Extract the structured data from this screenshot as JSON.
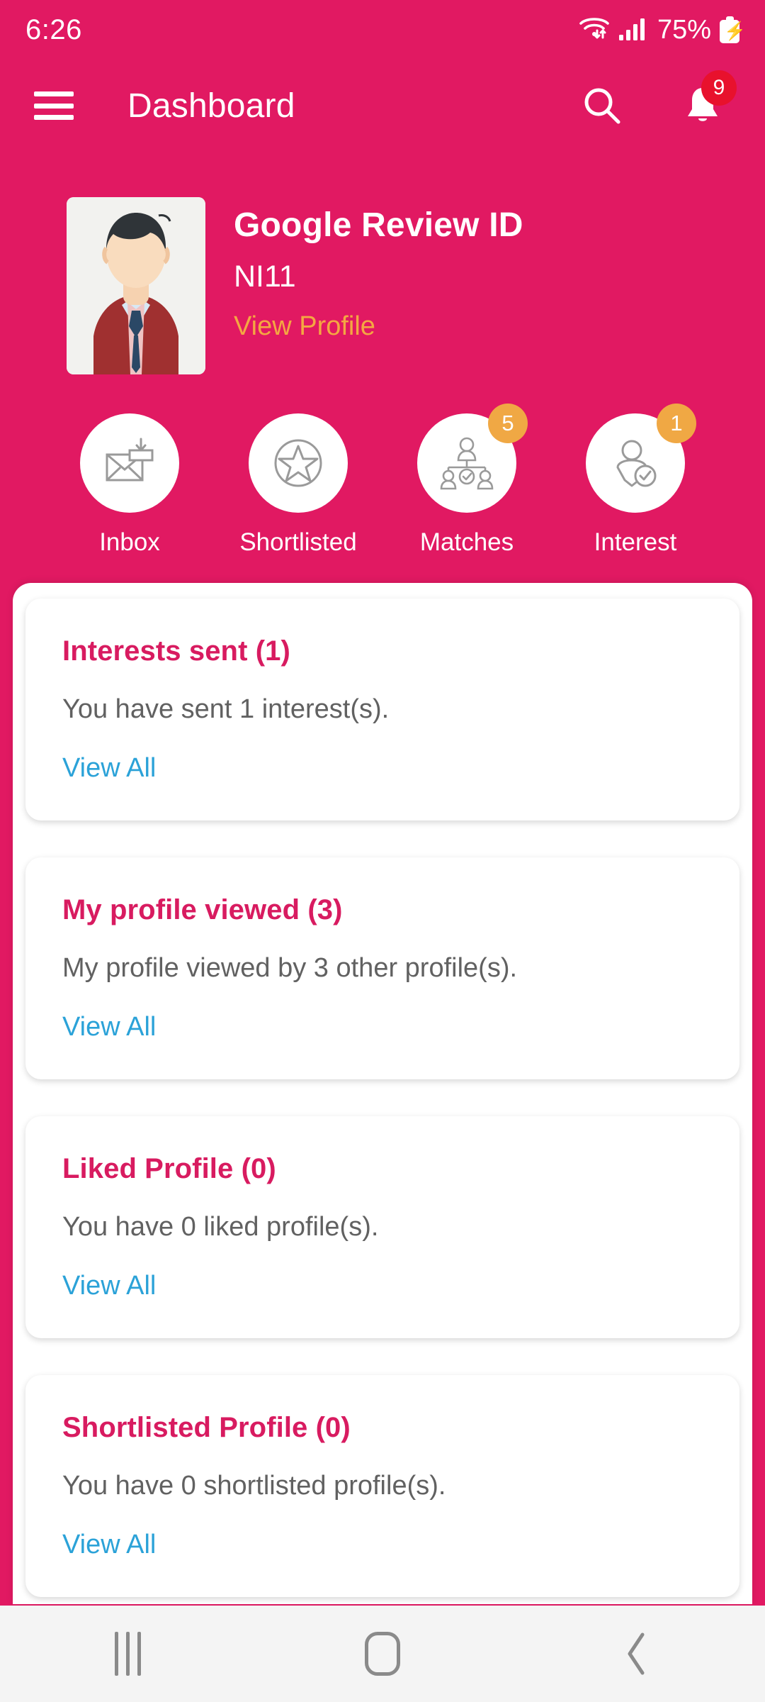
{
  "status_bar": {
    "time": "6:26",
    "battery_percent": "75%",
    "icons": [
      "wifi-icon",
      "cellular-signal-icon",
      "battery-charging-icon"
    ]
  },
  "app_bar": {
    "menu_icon": "hamburger-menu-icon",
    "title": "Dashboard",
    "search_icon": "search-icon",
    "notification_icon": "bell-icon",
    "notification_count": "9"
  },
  "profile": {
    "name": "Google Review ID",
    "id": "NI11",
    "view_profile_label": "View Profile",
    "avatar_icon": "user-avatar-photo"
  },
  "quick_actions": [
    {
      "label": "Inbox",
      "icon": "envelope-inbox-icon",
      "badge": ""
    },
    {
      "label": "Shortlisted",
      "icon": "star-circle-icon",
      "badge": ""
    },
    {
      "label": "Matches",
      "icon": "people-group-check-icon",
      "badge": "5"
    },
    {
      "label": "Interest",
      "icon": "person-check-icon",
      "badge": "1"
    }
  ],
  "cards": [
    {
      "title": "Interests sent (1)",
      "description": "You have sent 1 interest(s).",
      "link": "View All"
    },
    {
      "title": "My profile viewed (3)",
      "description": "My profile viewed by 3 other profile(s).",
      "link": "View All"
    },
    {
      "title": "Liked Profile (0)",
      "description": "You have 0 liked profile(s).",
      "link": "View All"
    },
    {
      "title": "Shortlisted Profile (0)",
      "description": "You have 0 shortlisted profile(s).",
      "link": "View All"
    }
  ],
  "nav_bar": {
    "recents_icon": "recents-icon",
    "home_icon": "home-icon",
    "back_icon": "back-chevron-icon"
  },
  "colors": {
    "brand_pink": "#E11962",
    "card_title": "#D81B60",
    "link_blue": "#2BA2D8",
    "accent_orange": "#F0A844",
    "profile_link_orange": "#F4A742",
    "badge_red": "#E8112D"
  }
}
